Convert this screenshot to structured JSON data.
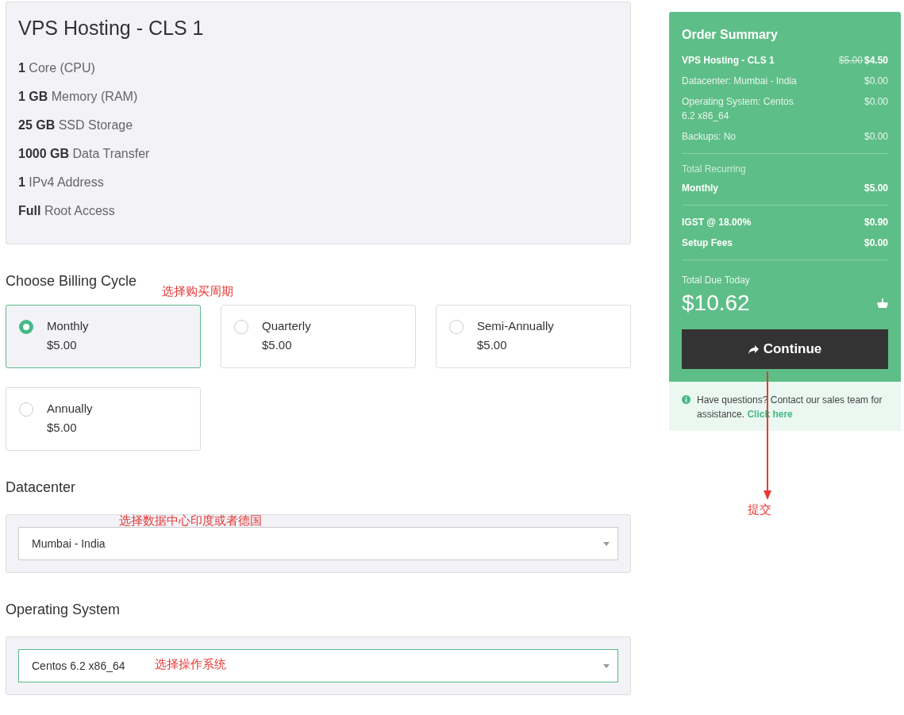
{
  "product": {
    "title": "VPS Hosting - CLS 1",
    "features": [
      "**1** Core (CPU)",
      "**1 GB** Memory (RAM)",
      "**25 GB** SSD Storage",
      "**1000 GB** Data Transfer",
      "**1** IPv4 Address",
      "**Full** Root Access"
    ]
  },
  "billing": {
    "heading": "Choose Billing Cycle",
    "options": [
      {
        "label": "Monthly",
        "price": "$5.00",
        "selected": true
      },
      {
        "label": "Quarterly",
        "price": "$5.00",
        "selected": false
      },
      {
        "label": "Semi-Annually",
        "price": "$5.00",
        "selected": false
      },
      {
        "label": "Annually",
        "price": "$5.00",
        "selected": false
      }
    ]
  },
  "datacenter": {
    "heading": "Datacenter",
    "value": "Mumbai - India",
    "focused": false
  },
  "operating_system": {
    "heading": "Operating System",
    "value": "Centos 6.2 x86_64",
    "focused": true
  },
  "summary": {
    "title": "Order Summary",
    "groups": [
      {
        "lines": [
          {
            "label": "VPS Hosting - CLS 1",
            "old_price": "$5.00",
            "price": "$4.50",
            "bold": true
          },
          {
            "label": "Datacenter: Mumbai - India",
            "price": "$0.00",
            "bold": false
          },
          {
            "label": "Operating System: Centos 6.2 x86_64",
            "price": "$0.00",
            "bold": false
          },
          {
            "label": "Backups: No",
            "price": "$0.00",
            "bold": false
          }
        ]
      },
      {
        "caption": "Total Recurring",
        "lines": [
          {
            "label": "Monthly",
            "price": "$5.00",
            "bold": true
          }
        ]
      },
      {
        "lines": [
          {
            "label": "IGST @ 18.00%",
            "price": "$0.90",
            "bold": true
          },
          {
            "label": "Setup Fees",
            "price": "$0.00",
            "bold": true
          }
        ]
      }
    ],
    "total_label": "Total Due Today",
    "total": "$10.62",
    "button": "Continue",
    "help": {
      "text": "Have questions? Contact our sales team for assistance. ",
      "link": "Click here"
    }
  },
  "annotations": [
    {
      "text": "选择购买周期",
      "kind": "label"
    },
    {
      "text": "选择数据中心印度或者德国",
      "kind": "label"
    },
    {
      "text": "选择操作系统",
      "kind": "label"
    },
    {
      "text": "提交",
      "kind": "arrow"
    }
  ]
}
